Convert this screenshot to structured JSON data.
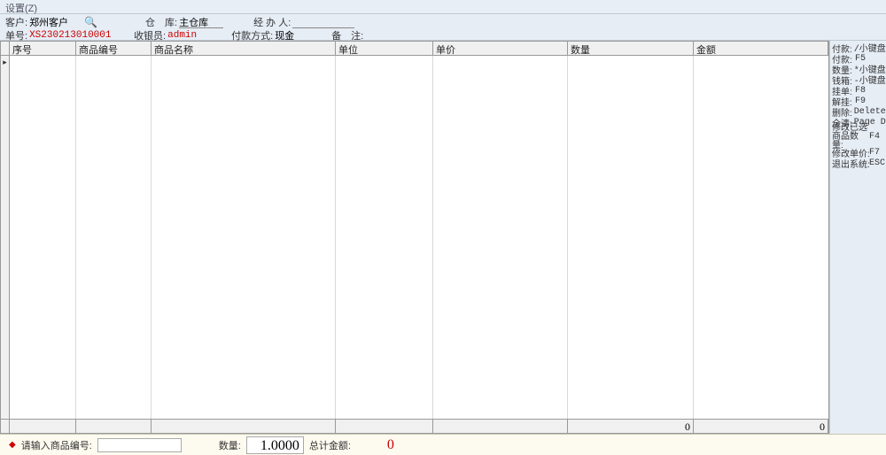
{
  "menubar": {
    "settings": "设置(Z)"
  },
  "header": {
    "customer_label": "客户:",
    "customer_value": "郑州客户",
    "warehouse_label": "仓　库:",
    "warehouse_value": "主仓库",
    "handler_label": "经 办 人:",
    "handler_value": "",
    "billno_label": "单号:",
    "billno_value": "XS230213010001",
    "cashier_label": "收银员:",
    "cashier_value": "admin",
    "paymethod_label": "付款方式:",
    "paymethod_value": "现金",
    "remark_label": "备　注:",
    "remark_value": ""
  },
  "grid": {
    "columns": [
      "序号",
      "商品编号",
      "商品名称",
      "单位",
      "单价",
      "数量",
      "金额"
    ],
    "footer_qty": "0",
    "footer_amount": "0"
  },
  "shortcuts": {
    "pay": {
      "label": "付款:",
      "key": "/小键盘"
    },
    "pay2": {
      "label": "付款:",
      "key": "F5"
    },
    "qty": {
      "label": "数量:",
      "key": "*小键盘"
    },
    "drawer": {
      "label": "钱箱:",
      "key": "-小键盘"
    },
    "hold": {
      "label": "挂单:",
      "key": "F8"
    },
    "unhold": {
      "label": "解挂:",
      "key": "F9"
    },
    "delete": {
      "label": "删除:",
      "key": "Delete"
    },
    "clear": {
      "label": "全清:",
      "key": "Page Down"
    },
    "modsel": {
      "label": "修改已选\n商品数量:",
      "key": "F4"
    },
    "modprice": {
      "label": "修改单价:",
      "key": "F7"
    },
    "exit": {
      "label": "退出系统:",
      "key": "ESC"
    }
  },
  "footer": {
    "prompt": "请输入商品编号:",
    "input_value": "",
    "qty_label": "数量:",
    "qty_value": "1.0000",
    "total_label": "总计金额:",
    "total_value": "0"
  }
}
